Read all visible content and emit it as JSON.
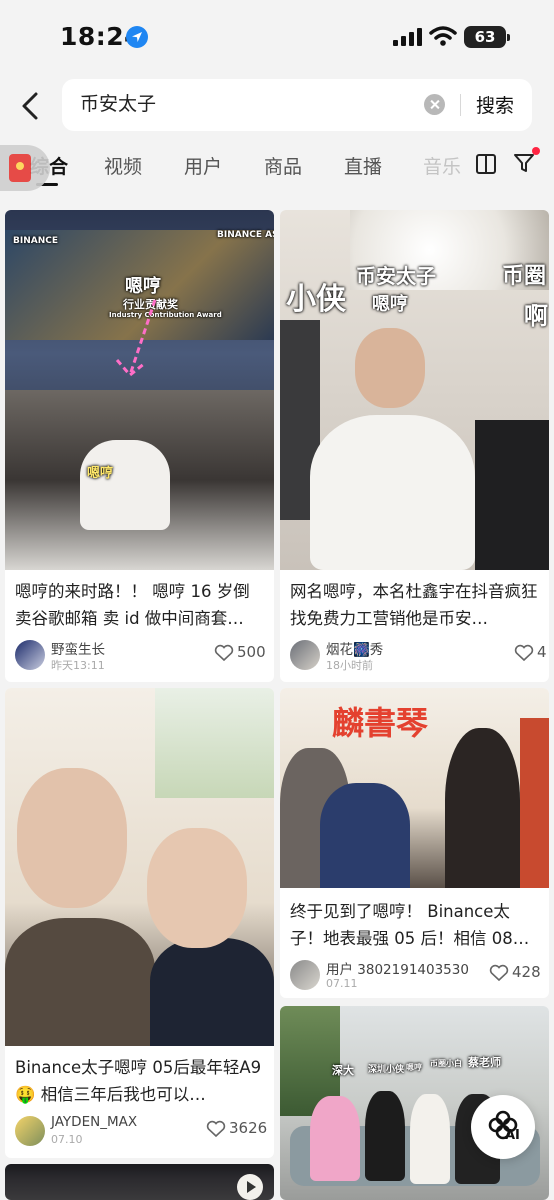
{
  "status_bar": {
    "time": "18:24",
    "battery": "63"
  },
  "search": {
    "query": "币安太子",
    "button_label": "搜索"
  },
  "tabs": [
    {
      "label": "综合",
      "active": true
    },
    {
      "label": "视频"
    },
    {
      "label": "用户"
    },
    {
      "label": "商品"
    },
    {
      "label": "直播"
    },
    {
      "label": "音乐"
    }
  ],
  "cards": [
    {
      "overlay": [
        "嗯哼",
        "行业贡献奖",
        "Industry Contribution Award",
        "BINANCE ASIA",
        "BINANCE"
      ],
      "title": "嗯哼的来时路！！ 嗯哼 16 岁倒卖谷歌邮箱 卖 id 做中间商套…",
      "author": "野蛮生长",
      "time": "昨天13:11",
      "likes": "500"
    },
    {
      "overlay": [
        "小侠",
        "币安太子",
        "嗯哼",
        "币圈",
        "啊"
      ],
      "title": "网名嗯哼，本名杜鑫宇在抖音疯狂找免费力工营销他是币安…",
      "author": "烟花🎆秀",
      "time": "18小时前",
      "likes": "4"
    },
    {
      "title": "Binance太子嗯哼 05后最年轻A9🤑 相信三年后我也可以…",
      "author": "JAYDEN_MAX",
      "time": "07.10",
      "likes": "3626"
    },
    {
      "overlay": [
        "麟書琴"
      ],
      "title": "终于见到了嗯哼！ Binance太子！地表最强 05 后！相信 08…",
      "author": "用户 3802191403530",
      "time": "07.11",
      "likes": "428"
    },
    {
      "overlay": [
        "深大",
        "深圳小侠",
        "嗯哼",
        "币圈小白",
        "蔡老师"
      ]
    }
  ],
  "ai_button": {
    "label": "AI"
  }
}
